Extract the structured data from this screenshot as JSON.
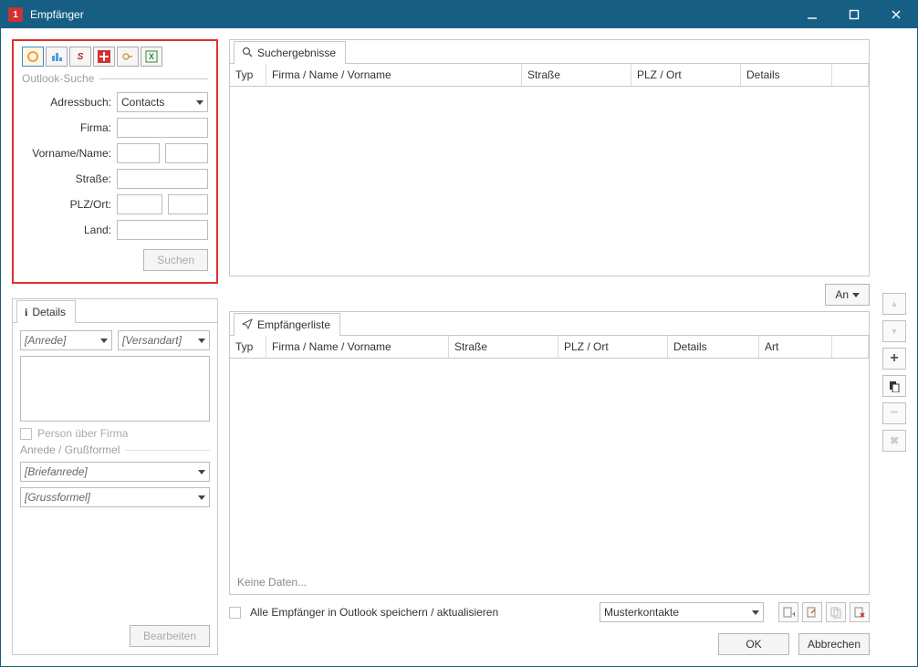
{
  "window": {
    "title": "Empfänger",
    "app_icon_label": "1"
  },
  "win_controls": {
    "minimize": "minimize",
    "maximize": "maximize",
    "close": "close"
  },
  "search_panel": {
    "section_label": "Outlook-Suche",
    "toolbar_icons": [
      "outlook-icon",
      "contacts-icon",
      "s-icon",
      "swiss-icon",
      "key-icon",
      "excel-icon"
    ],
    "labels": {
      "adressbuch": "Adressbuch:",
      "firma": "Firma:",
      "vorname_name": "Vorname/Name:",
      "strasse": "Straße:",
      "plz_ort": "PLZ/Ort:",
      "land": "Land:"
    },
    "adressbuch_value": "Contacts",
    "search_button": "Suchen"
  },
  "details_panel": {
    "tab_label": "Details",
    "anrede_placeholder": "[Anrede]",
    "versandart_placeholder": "[Versandart]",
    "checkbox_label": "Person über Firma",
    "section_label": "Anrede / Grußformel",
    "briefanrede_placeholder": "[Briefanrede]",
    "grussformel_placeholder": "[Grussformel]",
    "edit_button": "Bearbeiten"
  },
  "results_panel": {
    "tab_label": "Suchergebnisse",
    "columns": {
      "typ": "Typ",
      "firma": "Firma / Name / Vorname",
      "strasse": "Straße",
      "plz": "PLZ / Ort",
      "details": "Details"
    }
  },
  "an_button": "An",
  "recipients_panel": {
    "tab_label": "Empfängerliste",
    "columns": {
      "typ": "Typ",
      "firma": "Firma / Name / Vorname",
      "strasse": "Straße",
      "plz": "PLZ / Ort",
      "details": "Details",
      "art": "Art"
    },
    "no_data": "Keine Daten..."
  },
  "side_buttons": {
    "up": "▲",
    "down": "▼",
    "add": "+",
    "copy": "⎘",
    "remove": "−",
    "delete": "✖"
  },
  "bottom": {
    "checkbox_label": "Alle Empfänger in Outlook speichern / aktualisieren",
    "dropdown_value": "Musterkontakte",
    "mini_icons": [
      "add-contact-icon",
      "edit-contact-icon",
      "copy-contact-icon",
      "delete-contact-icon"
    ]
  },
  "footer": {
    "ok": "OK",
    "cancel": "Abbrechen"
  }
}
